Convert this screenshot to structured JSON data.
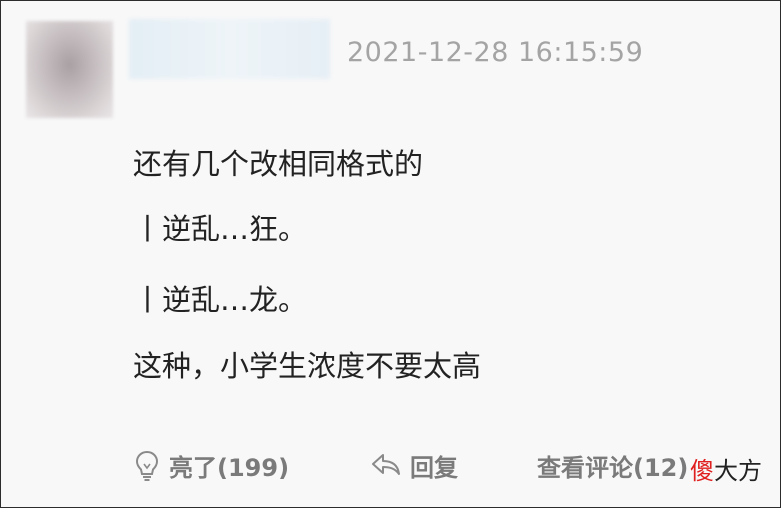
{
  "comment": {
    "timestamp": "2021-12-28 16:15:59",
    "lines": [
      "还有几个改相同格式的",
      "丨逆乱…狂。",
      "丨逆乱…龙。",
      "这种，小学生浓度不要太高"
    ]
  },
  "actions": {
    "like_label": "亮了(199)",
    "reply_label": "回复",
    "view_comments_label": "查看评论(12)"
  },
  "watermark": {
    "char1": "傻",
    "rest": "大方"
  },
  "icons": {
    "like": "lightbulb-icon",
    "reply": "reply-arrow-icon"
  },
  "colors": {
    "timestamp": "#a4a4a4",
    "action": "#7a7a7a",
    "watermark_accent": "#e02020"
  }
}
